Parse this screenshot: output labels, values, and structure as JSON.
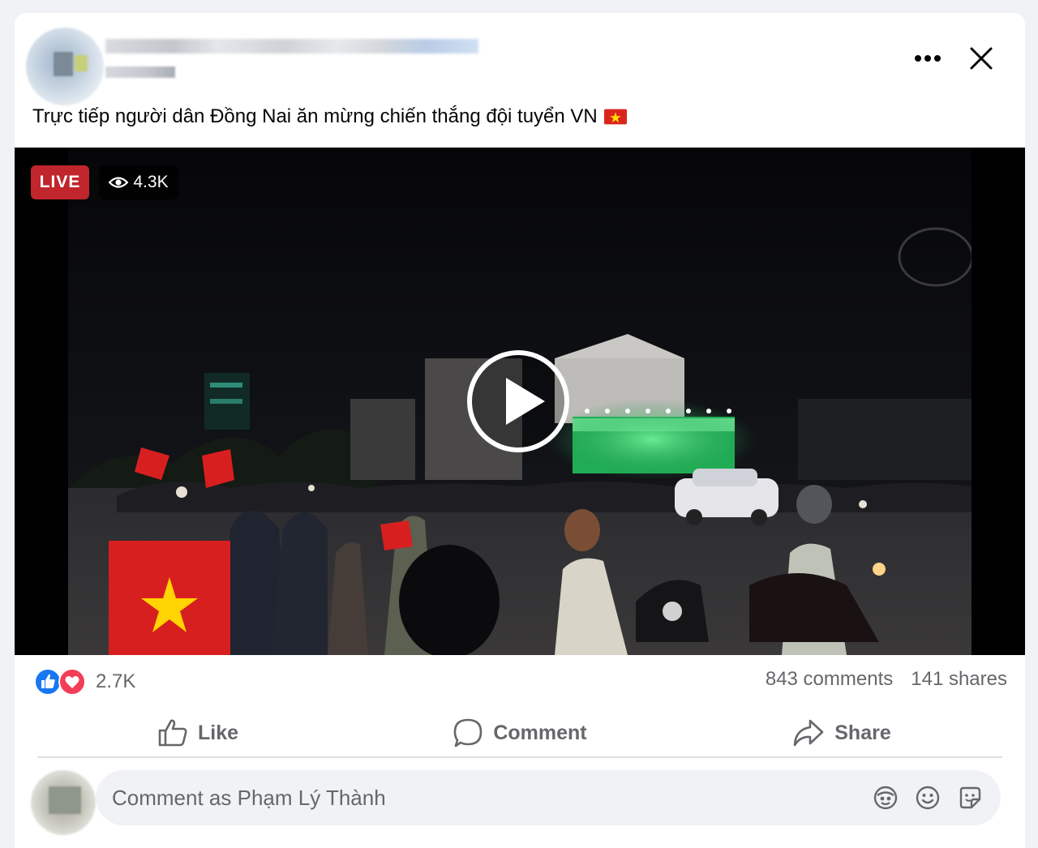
{
  "post": {
    "text": "Trực tiếp người dân Đồng Nai ăn mừng chiến thắng đội tuyển VN",
    "flag_icon": "vietnam-flag-icon"
  },
  "video": {
    "live_label": "LIVE",
    "viewers": "4.3K"
  },
  "stats": {
    "reaction_icons": [
      "like-reaction-icon",
      "love-reaction-icon"
    ],
    "reaction_count": "2.7K",
    "comments": "843 comments",
    "shares": "141 shares"
  },
  "actions": {
    "like_label": "Like",
    "comment_label": "Comment",
    "share_label": "Share"
  },
  "comment_box": {
    "placeholder": "Comment as Phạm Lý Thành"
  },
  "colors": {
    "live_red": "#c0262c",
    "like_blue": "#1877f2",
    "love_red": "#f33e58",
    "muted_text": "#65676b"
  }
}
